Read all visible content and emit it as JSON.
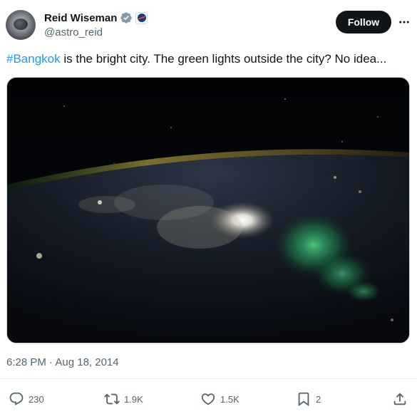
{
  "author": {
    "name": "Reid Wiseman",
    "handle": "@astro_reid",
    "avatar_icon": "astronaut-avatar",
    "verified_icon": "verified-badge-icon",
    "affiliation_icon": "nasa-badge-icon"
  },
  "header": {
    "follow_label": "Follow",
    "more_icon": "more-icon"
  },
  "tweet": {
    "hashtag": "#Bangkok",
    "text": " is the bright city. The green lights outside the city? No idea...",
    "timestamp": "6:28 PM · Aug 18, 2014"
  },
  "media": {
    "description_icon": "photo-icon"
  },
  "actions": {
    "replies": "230",
    "reposts": "1.9K",
    "likes": "1.5K",
    "bookmarks": "2"
  },
  "colors": {
    "accent": "#1d9bf0",
    "text": "#0f1419",
    "muted": "#536471",
    "button_bg": "#0f1419"
  }
}
